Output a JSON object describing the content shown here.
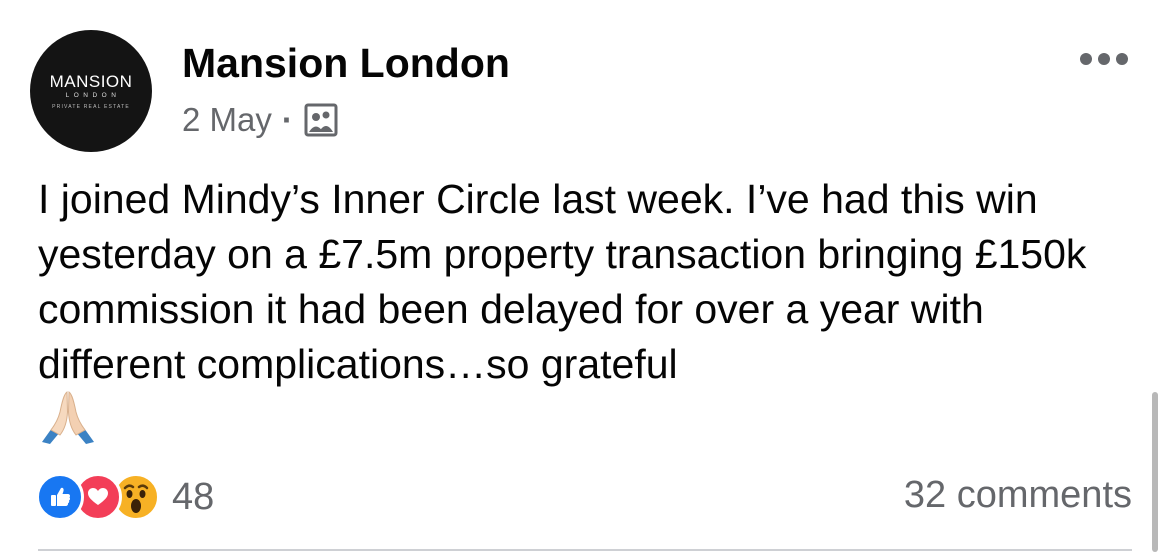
{
  "post": {
    "page_name": "Mansion London",
    "avatar": {
      "logo_main": "MANSION",
      "logo_sub": "LONDON",
      "logo_tag": "PRIVATE REAL ESTATE",
      "background": "#141414"
    },
    "date": "2 May",
    "separator": "·",
    "audience_icon": "group-photo-icon",
    "more_icon": "more-options-icon",
    "text": "I joined Mindy’s Inner Circle last week. I’ve had this win yesterday on a £7.5m property transaction bringing £150k commission it had been delayed for over a year with different complications…so grateful",
    "emoji": "folded-hands-emoji"
  },
  "engagement": {
    "reactions": [
      {
        "name": "like",
        "icon": "like-reaction-icon",
        "color": "#1877f2"
      },
      {
        "name": "love",
        "icon": "love-reaction-icon",
        "color": "#f33e58"
      },
      {
        "name": "wow",
        "icon": "wow-reaction-icon",
        "color": "#f7b125"
      }
    ],
    "reaction_count": "48",
    "comments": "32 comments"
  },
  "colors": {
    "primary_text": "#050505",
    "secondary_text": "#65676b",
    "divider": "#ced0d4"
  }
}
